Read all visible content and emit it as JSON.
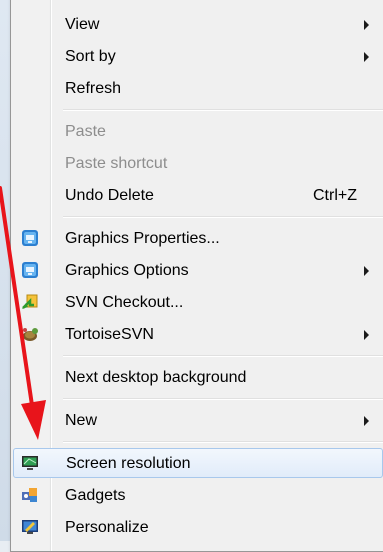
{
  "menu": {
    "items": [
      {
        "label": "View",
        "submenu": true
      },
      {
        "label": "Sort by",
        "submenu": true
      },
      {
        "label": "Refresh"
      },
      {
        "label": "Paste",
        "disabled": true
      },
      {
        "label": "Paste shortcut",
        "disabled": true
      },
      {
        "label": "Undo Delete",
        "shortcut": "Ctrl+Z"
      },
      {
        "label": "Graphics Properties...",
        "icon": "intel-graphics-icon"
      },
      {
        "label": "Graphics Options",
        "icon": "intel-graphics-icon",
        "submenu": true
      },
      {
        "label": "SVN Checkout...",
        "icon": "svn-checkout-icon"
      },
      {
        "label": "TortoiseSVN",
        "icon": "tortoisesvn-icon",
        "submenu": true
      },
      {
        "label": "Next desktop background"
      },
      {
        "label": "New",
        "submenu": true
      },
      {
        "label": "Screen resolution",
        "icon": "monitor-icon",
        "highlighted": true
      },
      {
        "label": "Gadgets",
        "icon": "gadgets-icon"
      },
      {
        "label": "Personalize",
        "icon": "personalize-icon"
      }
    ]
  },
  "colors": {
    "highlight_border": "#a8c8ec",
    "annotation_arrow": "#e8141b",
    "disabled_text": "#8d8d8d"
  }
}
